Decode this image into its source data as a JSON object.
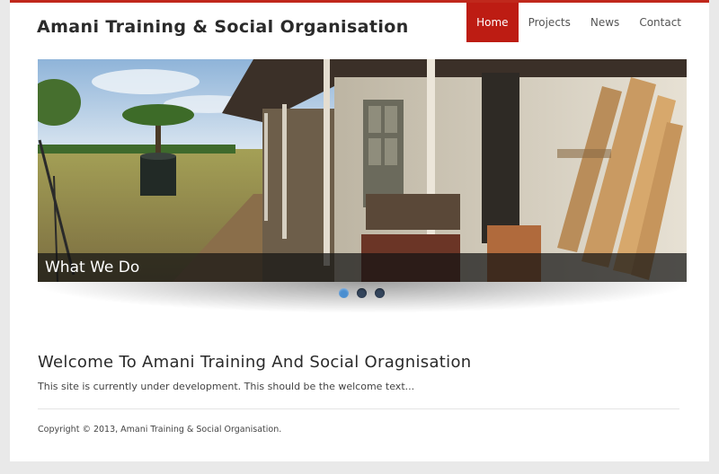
{
  "header": {
    "site_title": "Amani Training & Social Organisation",
    "nav": [
      {
        "label": "Home",
        "active": true
      },
      {
        "label": "Projects",
        "active": false
      },
      {
        "label": "News",
        "active": false
      },
      {
        "label": "Contact",
        "active": false
      }
    ]
  },
  "slider": {
    "caption": "What We Do",
    "dots": [
      true,
      false,
      false
    ]
  },
  "main": {
    "title": "Welcome To Amani Training And Social Oragnisation",
    "text": "This site is currently under development. This should be the welcome text..."
  },
  "footer": {
    "copyright": "Copyright © 2013, Amani Training & Social Organisation."
  },
  "colors": {
    "accent": "#bd1c13",
    "dot_active": "#4a8ed0",
    "dot_inactive": "#34455c"
  }
}
